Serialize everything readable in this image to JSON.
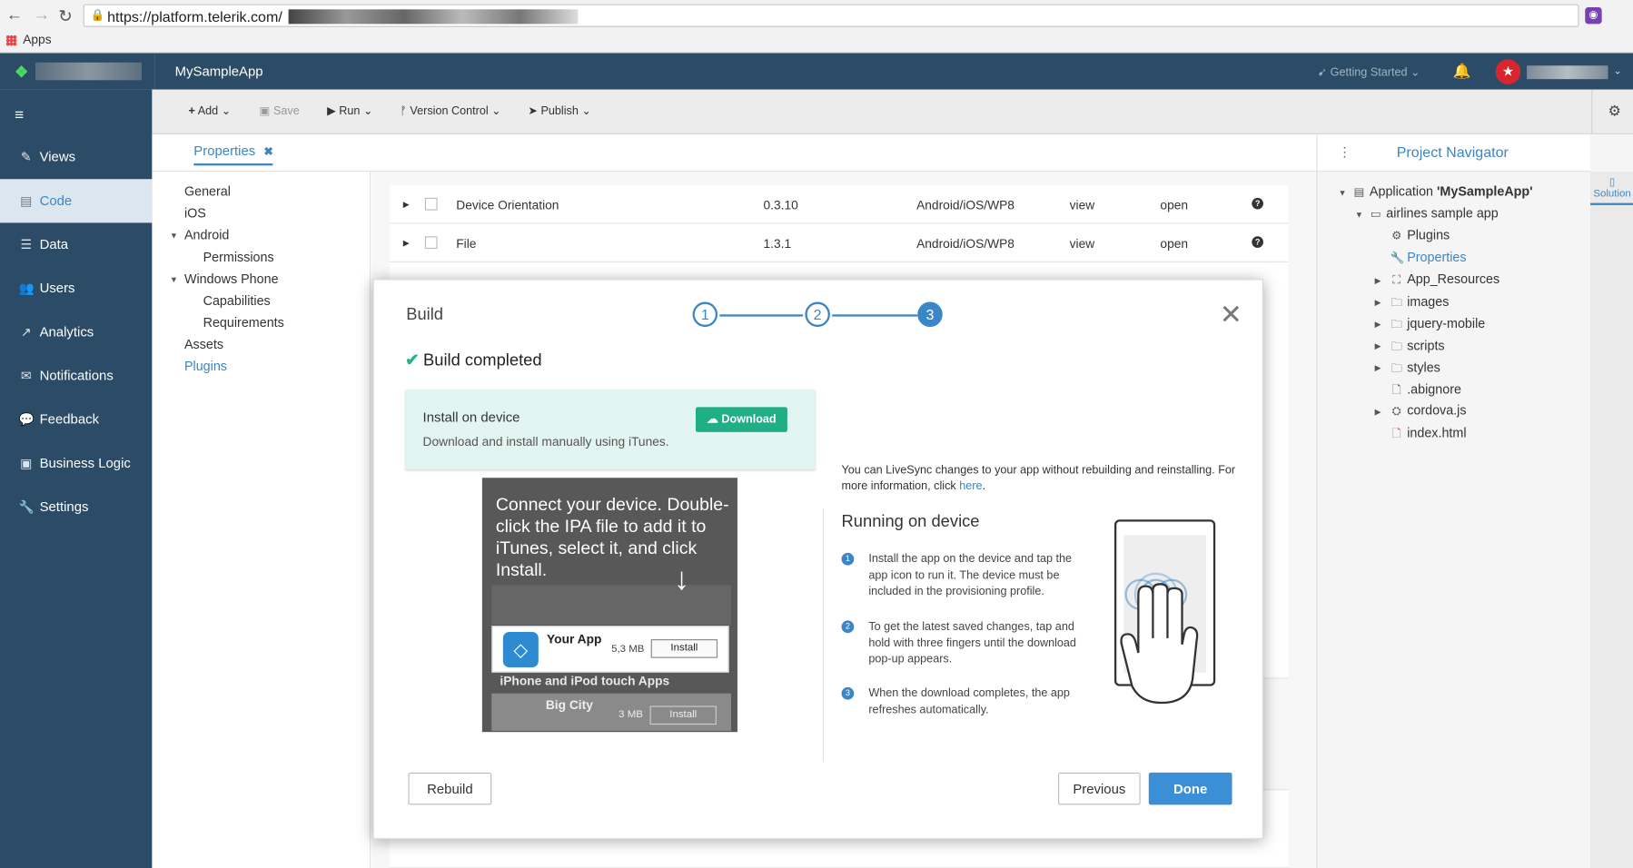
{
  "browser": {
    "url": "https://platform.telerik.com/",
    "bookmarks_apps": "Apps"
  },
  "topbar": {
    "app_name": "MySampleApp",
    "getting_started": "Getting Started"
  },
  "sidebar": {
    "items": [
      {
        "label": "Views",
        "icon": "pencil-icon"
      },
      {
        "label": "Code",
        "icon": "code-file-icon"
      },
      {
        "label": "Data",
        "icon": "database-icon"
      },
      {
        "label": "Users",
        "icon": "users-icon"
      },
      {
        "label": "Analytics",
        "icon": "chart-icon"
      },
      {
        "label": "Notifications",
        "icon": "envelope-icon"
      },
      {
        "label": "Feedback",
        "icon": "comment-icon"
      },
      {
        "label": "Business Logic",
        "icon": "briefcase-icon"
      },
      {
        "label": "Settings",
        "icon": "wrench-icon"
      }
    ],
    "active": "Code"
  },
  "toolbar": {
    "add": "Add",
    "save": "Save",
    "run": "Run",
    "version_control": "Version Control",
    "publish": "Publish"
  },
  "properties_tab": {
    "label": "Properties",
    "nav": [
      "General",
      "iOS",
      "Android",
      "Permissions",
      "Windows Phone",
      "Capabilities",
      "Requirements",
      "Assets",
      "Plugins"
    ],
    "active": "Plugins"
  },
  "plugins_table": {
    "rows": [
      {
        "name": "Device Orientation",
        "version": "0.3.10",
        "platforms": "Android/iOS/WP8",
        "view": "view",
        "open": "open"
      },
      {
        "name": "File",
        "version": "1.3.1",
        "platforms": "Android/iOS/WP8",
        "view": "view",
        "open": "open"
      }
    ]
  },
  "project_navigator": {
    "title": "Project Navigator",
    "side_tab": "Solution",
    "tree": {
      "application_prefix": "Application ",
      "application_name": "'MySampleApp'",
      "project": "airlines sample app",
      "items": [
        "Plugins",
        "Properties",
        "App_Resources",
        "images",
        "jquery-mobile",
        "scripts",
        "styles",
        ".abignore",
        "cordova.js",
        "index.html"
      ]
    }
  },
  "modal": {
    "title": "Build",
    "steps": [
      "1",
      "2",
      "3"
    ],
    "current_step": 3,
    "status": "Build completed",
    "install": {
      "title": "Install on device",
      "description": "Download and install manually using iTunes.",
      "download_button": "Download"
    },
    "itunes": {
      "caption": "Connect your device. Double-click the IPA file to add it to iTunes, select it, and click Install.",
      "your_app_name": "Your App",
      "your_app_size": "5,3 MB",
      "install_label": "Install",
      "section": "iPhone and iPod touch Apps",
      "big_city_name": "Big City",
      "big_city_size": "3 MB"
    },
    "livesync_text": "You can LiveSync changes to your app without rebuilding and reinstalling. For more information, click ",
    "livesync_link": "here",
    "livesync_end": ".",
    "running_title": "Running on device",
    "running_steps": [
      "Install the app on the device and tap the app icon to run it. The device must be included in the provisioning profile.",
      "To get the latest saved changes, tap and hold with three fingers until the download pop-up appears.",
      "When the download completes, the app refreshes automatically."
    ],
    "buttons": {
      "rebuild": "Rebuild",
      "previous": "Previous",
      "done": "Done"
    }
  }
}
